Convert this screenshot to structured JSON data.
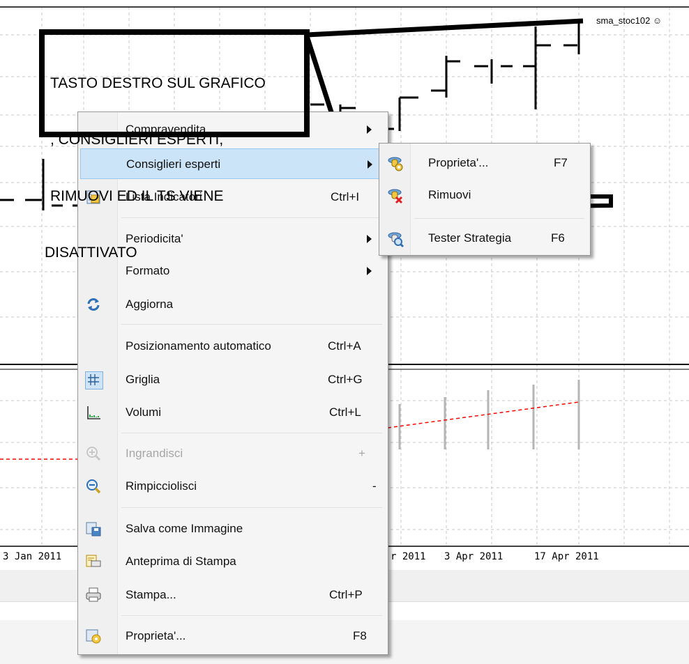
{
  "chart": {
    "symbol_label": "sma_stoc102 ☺",
    "dates": [
      "3 Jan 2011",
      "r 2011",
      "3 Apr 2011",
      "17 Apr 2011"
    ]
  },
  "annotation": {
    "text_lines": [
      "TASTO DESTRO SUL GRAFICO",
      ", CONSIGLIERI ESPERTI,",
      "RIMUOVI ED IL TS VIENE",
      "DISATTIVATO"
    ]
  },
  "context_menu": {
    "items": [
      {
        "label": "Compravendita",
        "shortcut": "",
        "submenu": true,
        "icon": "none"
      },
      {
        "label": "Consiglieri esperti",
        "shortcut": "",
        "submenu": true,
        "icon": "none",
        "highlighted": true
      },
      {
        "label": "Lista Indicatori",
        "shortcut": "Ctrl+I",
        "icon": "indicators-list-icon"
      },
      {
        "label": "Periodicita'",
        "shortcut": "",
        "submenu": true,
        "icon": "none"
      },
      {
        "label": "Formato",
        "shortcut": "",
        "submenu": true,
        "icon": "none"
      },
      {
        "label": "Aggiorna",
        "shortcut": "",
        "icon": "refresh-icon"
      },
      {
        "label": "Posizionamento automatico",
        "shortcut": "Ctrl+A",
        "icon": "none"
      },
      {
        "label": "Griglia",
        "shortcut": "Ctrl+G",
        "icon": "grid-icon"
      },
      {
        "label": "Volumi",
        "shortcut": "Ctrl+L",
        "icon": "volumes-icon"
      },
      {
        "label": "Ingrandisci",
        "shortcut": "+",
        "icon": "zoom-in-icon",
        "disabled": true
      },
      {
        "label": "Rimpicciolisci",
        "shortcut": "-",
        "icon": "zoom-out-icon"
      },
      {
        "label": "Salva come Immagine",
        "shortcut": "",
        "icon": "save-image-icon"
      },
      {
        "label": "Anteprima di Stampa",
        "shortcut": "",
        "icon": "print-preview-icon"
      },
      {
        "label": "Stampa...",
        "shortcut": "Ctrl+P",
        "icon": "print-icon"
      },
      {
        "label": "Proprieta'...",
        "shortcut": "F8",
        "icon": "properties-icon"
      }
    ]
  },
  "submenu": {
    "items": [
      {
        "label": "Proprieta'...",
        "shortcut": "F7",
        "icon": "expert-properties-icon"
      },
      {
        "label": "Rimuovi",
        "shortcut": "",
        "icon": "expert-remove-icon"
      },
      {
        "label": "Tester Strategia",
        "shortcut": "F6",
        "icon": "strategy-tester-icon"
      }
    ]
  },
  "colors": {
    "menu_bg": "#f5f5f5",
    "highlight": "#cce4f7",
    "signal_line": "#ff0000"
  }
}
